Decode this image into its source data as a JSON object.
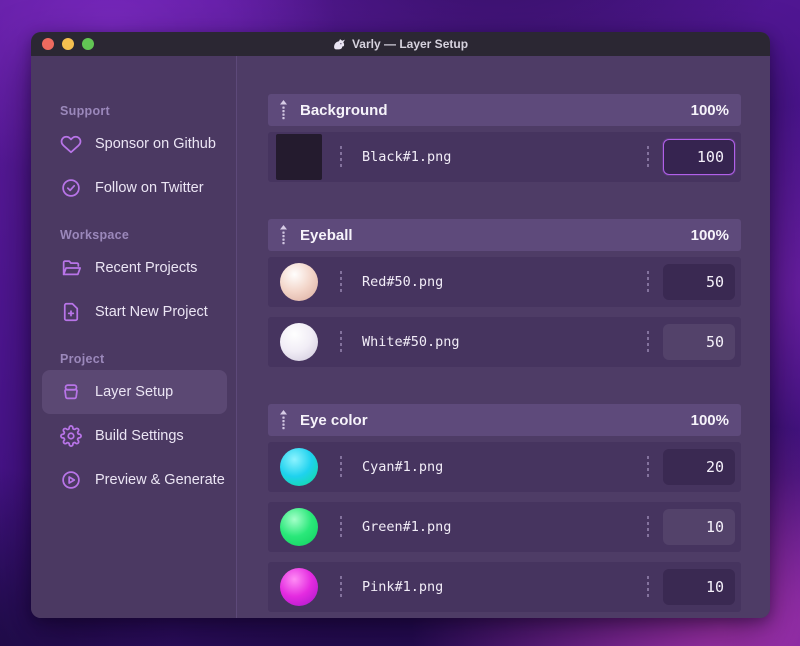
{
  "window": {
    "title": "Varly — Layer Setup",
    "app_icon": "unicorn-icon",
    "traffic_lights": {
      "close": "#ee6a5f",
      "minimize": "#f5bf4f",
      "zoom": "#62c554"
    }
  },
  "colors": {
    "accent_purple": "#b874e8",
    "focus_border": "#b160ea",
    "header_bg": "#5e4a7b",
    "row_bg": "#46345f",
    "sidebar_bg": "#4b3962"
  },
  "sidebar": {
    "sections": [
      {
        "label": "Support",
        "items": [
          {
            "icon": "heart-icon",
            "label": "Sponsor on Github",
            "active": false
          },
          {
            "icon": "badge-check-icon",
            "label": "Follow on Twitter",
            "active": false
          }
        ]
      },
      {
        "label": "Workspace",
        "items": [
          {
            "icon": "folder-open-icon",
            "label": "Recent Projects",
            "active": false
          },
          {
            "icon": "file-plus-icon",
            "label": "Start New Project",
            "active": false
          }
        ]
      },
      {
        "label": "Project",
        "items": [
          {
            "icon": "archive-icon",
            "label": "Layer Setup",
            "active": true
          },
          {
            "icon": "gear-icon",
            "label": "Build Settings",
            "active": false
          },
          {
            "icon": "play-circle-icon",
            "label": "Preview & Generate",
            "active": false
          }
        ]
      }
    ]
  },
  "main": {
    "groups": [
      {
        "name": "Background",
        "opacity": "100%",
        "layers": [
          {
            "file": "Black#1.png",
            "value": "100",
            "state": "focused",
            "thumb": {
              "shape": "square",
              "colors": [
                "#241b2e"
              ]
            }
          }
        ]
      },
      {
        "name": "Eyeball",
        "opacity": "100%",
        "layers": [
          {
            "file": "Red#50.png",
            "value": "50",
            "state": "plain",
            "thumb": {
              "shape": "sphere",
              "colors": [
                "#fffefd",
                "#f3d6ca",
                "#d9aa9d"
              ]
            }
          },
          {
            "file": "White#50.png",
            "value": "50",
            "state": "hover",
            "thumb": {
              "shape": "sphere",
              "colors": [
                "#ffffff",
                "#f1edf6",
                "#cdc5d9"
              ]
            }
          }
        ]
      },
      {
        "name": "Eye color",
        "opacity": "100%",
        "layers": [
          {
            "file": "Cyan#1.png",
            "value": "20",
            "state": "plain",
            "thumb": {
              "shape": "sphere",
              "colors": [
                "#8df3ff",
                "#1fd2ee",
                "#10dc92"
              ]
            }
          },
          {
            "file": "Green#1.png",
            "value": "10",
            "state": "hover",
            "thumb": {
              "shape": "sphere",
              "colors": [
                "#a4ffc9",
                "#2ae87a",
                "#0fce5e"
              ]
            }
          },
          {
            "file": "Pink#1.png",
            "value": "10",
            "state": "plain",
            "thumb": {
              "shape": "sphere",
              "colors": [
                "#ff8df5",
                "#e42be0",
                "#a614c9"
              ]
            }
          }
        ]
      }
    ]
  }
}
